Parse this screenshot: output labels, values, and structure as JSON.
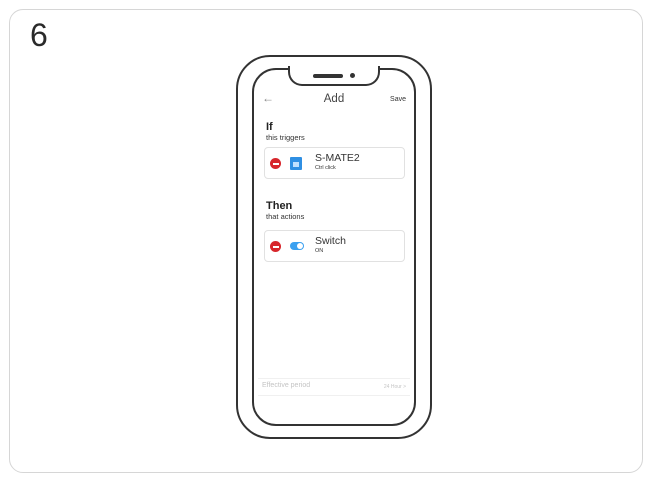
{
  "step": {
    "number": "6"
  },
  "screen": {
    "header": {
      "back_icon": "arrow-left-icon",
      "title": "Add",
      "save_label": "Save"
    },
    "if_section": {
      "title": "If",
      "subtitle": "this triggers",
      "item": {
        "name": "S-MATE2",
        "state": "Ctrl click",
        "remove_icon": "remove-circle-icon",
        "device_icon": "smart-device-icon"
      }
    },
    "then_section": {
      "title": "Then",
      "subtitle": "that actions",
      "item": {
        "name": "Switch",
        "state": "ON",
        "remove_icon": "remove-circle-icon",
        "device_icon": "toggle-switch-icon"
      }
    },
    "effective_period": {
      "label": "Effective period",
      "value": "24 Hour >"
    }
  },
  "colors": {
    "remove": "#d7262b",
    "accent": "#2f8fe3",
    "switch": "#3aa0f0"
  }
}
